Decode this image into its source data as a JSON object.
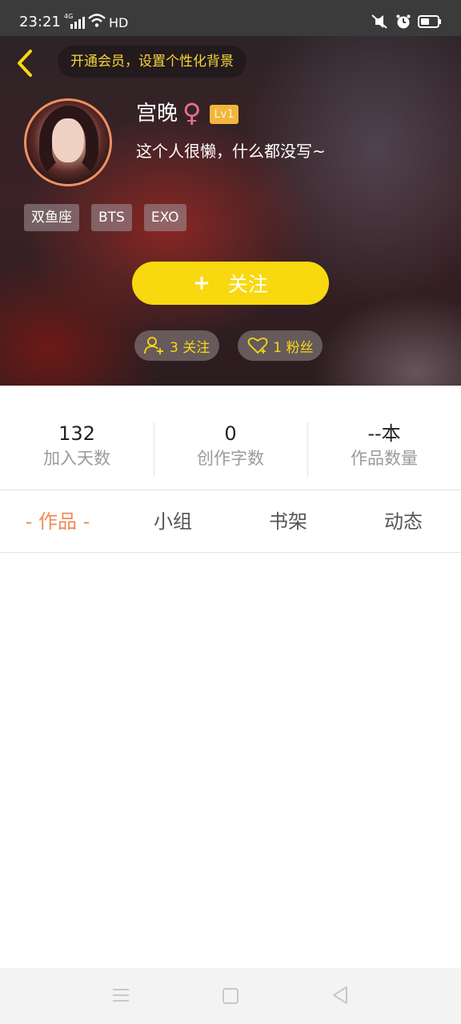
{
  "status_bar": {
    "time": "23:21",
    "network_label": "4G",
    "hd_label": "HD",
    "icons": [
      "signal-icon",
      "wifi-icon",
      "mute-icon",
      "alarm-icon",
      "battery-icon"
    ]
  },
  "header": {
    "vip_prompt": "开通会员，设置个性化背景",
    "accent_color": "#f8d80f"
  },
  "profile": {
    "name": "宫晚",
    "gender_symbol": "♀",
    "level": "Lv1",
    "bio": "这个人很懒，什么都没写~",
    "tags": [
      "双鱼座",
      "BTS",
      "EXO"
    ],
    "follow_plus": "+",
    "follow_label": "关注",
    "following_count": "3 关注",
    "fans_count": "1 粉丝"
  },
  "stats": [
    {
      "value": "132",
      "label": "加入天数"
    },
    {
      "value": "0",
      "label": "创作字数"
    },
    {
      "value": "--本",
      "label": "作品数量"
    }
  ],
  "tabs": [
    {
      "label": "- 作品 -",
      "active": true
    },
    {
      "label": "小组",
      "active": false
    },
    {
      "label": "书架",
      "active": false
    },
    {
      "label": "动态",
      "active": false
    }
  ]
}
